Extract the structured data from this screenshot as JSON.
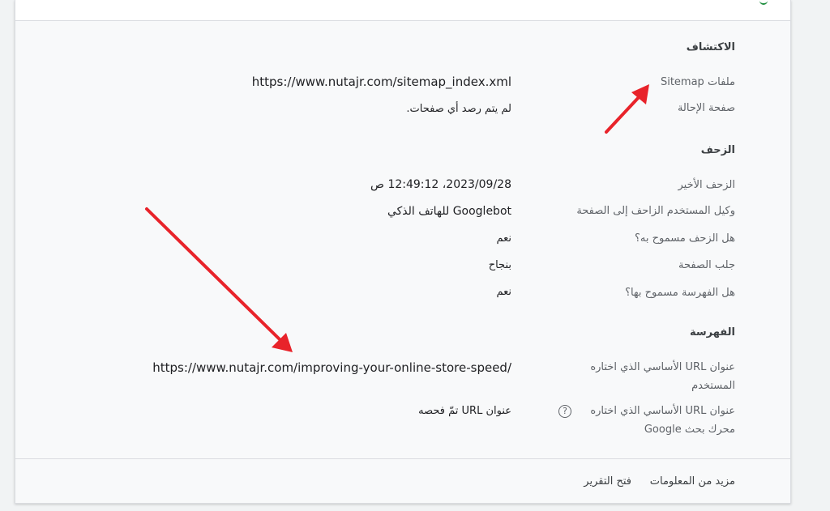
{
  "discovery": {
    "title": "الاكتشاف",
    "sitemaps_label": "ملفات Sitemap",
    "sitemaps_value": "https://www.nutajr.com/sitemap_index.xml",
    "referring_label": "صفحة الإحالة",
    "referring_value": "لم يتم رصد أي صفحات."
  },
  "crawl": {
    "title": "الزحف",
    "last_crawl_label": "الزحف الأخير",
    "last_crawl_value": "2023/09/28، 12:49:12 ص",
    "user_agent_label": "وكيل المستخدم الزاحف إلى الصفحة",
    "user_agent_value": "Googlebot للهاتف الذكي",
    "crawl_allowed_label": "هل الزحف مسموح به؟",
    "crawl_allowed_value": "نعم",
    "page_fetch_label": "جلب الصفحة",
    "page_fetch_value": "بنجاح",
    "indexing_allowed_label": "هل الفهرسة مسموح بها؟",
    "indexing_allowed_value": "نعم"
  },
  "indexing": {
    "title": "الفهرسة",
    "user_canonical_label": "عنوان URL الأساسي الذي اختاره المستخدم",
    "user_canonical_value": "https://www.nutajr.com/improving-your-online-store-speed/",
    "google_canonical_label": "عنوان URL الأساسي الذي اختاره محرك بحث Google",
    "google_canonical_value": "عنوان URL تمّ فحصه",
    "help_icon": "?"
  },
  "footer": {
    "learn_more": "مزيد من المعلومات",
    "open_report": "فتح التقرير"
  },
  "colors": {
    "arrow": "#e8232a",
    "status_green": "#1e8e3e"
  }
}
